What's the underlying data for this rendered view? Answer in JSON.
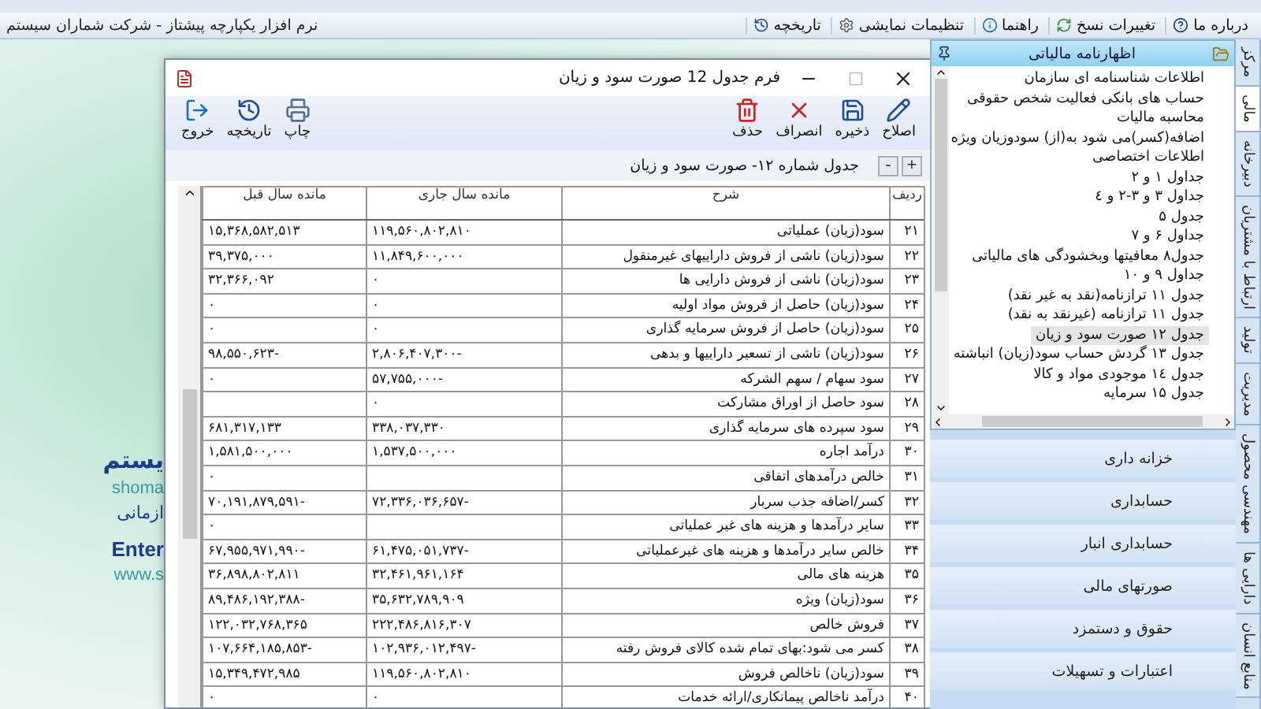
{
  "menu_bar": {
    "app_title": "نرم افزار یکپارچه پیشتاز - شرکت شماران سیستم",
    "items": [
      "درباره ما",
      "تغییرات نسخ",
      "راهنما",
      "تنظیمات نمایشی",
      "تاریخچه"
    ]
  },
  "background_logo": [
    {
      "text": "یستم",
      "kind": "title"
    },
    {
      "text": "shoma",
      "kind": "latin"
    },
    {
      "text": "ازمانی",
      "kind": "subtitle"
    },
    {
      "text": "Enter",
      "kind": "bold"
    },
    {
      "text": "www.s",
      "kind": "latin"
    }
  ],
  "dialog": {
    "title": "فرم جدول 12 صورت سود و زیان",
    "toolbar_right": [
      "اصلاح",
      "ذخیره",
      "انصراف",
      "حذف"
    ],
    "toolbar_left": [
      "چاپ",
      "تاریخچه",
      "خروج"
    ],
    "heading": "جدول شماره ۱۲- صورت سود و زیان",
    "expand_buttons": [
      "+",
      "-"
    ],
    "table": {
      "columns": [
        "ردیف",
        "شرح",
        "مانده سال جاری",
        "مانده سال قبل"
      ],
      "rows": [
        {
          "no": "۲۱",
          "description": "سود(زیان) عملیاتی",
          "current": "۱۱۹,۵۶۰,۸۰۲,۸۱۰",
          "previous": "۱۵,۳۶۸,۵۸۲,۵۱۳"
        },
        {
          "no": "۲۲",
          "description": "سود(زیان) ناشی از فروش داراییهای غیرمنقول",
          "current": "۱۱,۸۴۹,۶۰۰,۰۰۰",
          "previous": "۳۹,۳۷۵,۰۰۰"
        },
        {
          "no": "۲۳",
          "description": "سود(زیان) ناشی از فروش دارایی ها",
          "current": "۰",
          "previous": "۳۲,۳۶۶,۰۹۲"
        },
        {
          "no": "۲۴",
          "description": "سود(زیان) حاصل از فروش مواد اولیه",
          "current": "۰",
          "previous": "۰"
        },
        {
          "no": "۲۵",
          "description": "سود(زیان) حاصل از فروش سرمایه گذاری",
          "current": "۰",
          "previous": "۰"
        },
        {
          "no": "۲۶",
          "description": "سود(زیان) ناشی از تسعیر داراییها و بدهی",
          "current": "-۲,۸۰۶,۴۰۷,۳۰۰",
          "previous": "-۹۸,۵۵۰,۶۲۳"
        },
        {
          "no": "۲۷",
          "description": "سود سهام / سهم الشرکه",
          "current": "-۵۷,۷۵۵,۰۰۰",
          "previous": "۰"
        },
        {
          "no": "۲۸",
          "description": "سود حاصل از اوراق مشارکت",
          "current": "۰"
        },
        {
          "no": "۲۹",
          "description": "سود سپرده های سرمایه گذاری",
          "current": "۳۳۸,۰۳۷,۳۳۰",
          "previous": "۶۸۱,۳۱۷,۱۳۳"
        },
        {
          "no": "۳۰",
          "description": "درآمد اجاره",
          "current": "۱,۵۳۷,۵۰۰,۰۰۰",
          "previous": "۱,۵۸۱,۵۰۰,۰۰۰"
        },
        {
          "no": "۳۱",
          "description": "خالص درآمدهای اتفاقی",
          "previous": "۰"
        },
        {
          "no": "۳۲",
          "description": "کسر/اضافه جذب سربار",
          "current": "-۷۲,۳۳۶,۰۳۶,۶۵۷",
          "previous": "-۷۰,۱۹۱,۸۷۹,۵۹۱"
        },
        {
          "no": "۳۳",
          "description": "سایر درآمدها و هزینه های غیر عملیاتی",
          "previous": "۰"
        },
        {
          "no": "۳۴",
          "description": "خالص سایر درآمدها و هزینه های غیرعملیاتی",
          "current": "-۶۱,۴۷۵,۰۵۱,۷۳۷",
          "previous": "-۶۷,۹۵۵,۹۷۱,۹۹۰"
        },
        {
          "no": "۳۵",
          "description": "هزینه های مالی",
          "current": "۳۲,۴۶۱,۹۶۱,۱۶۴",
          "previous": "۳۶,۸۹۸,۸۰۲,۸۱۱"
        },
        {
          "no": "۳۶",
          "description": "سود(زیان) ویژه",
          "current": "۳۵,۶۳۲,۷۸۹,۹۰۹",
          "previous": "-۸۹,۴۸۶,۱۹۲,۳۸۸"
        },
        {
          "no": "۳۷",
          "description": "فروش خالص",
          "current": "۲۲۲,۴۸۶,۸۱۶,۳۰۷",
          "previous": "۱۲۲,۰۳۲,۷۶۸,۳۶۵"
        },
        {
          "no": "۳۸",
          "description": "کسر می شود:بهای تمام شده کالای فروش رفته",
          "current": "-۱۰۲,۹۳۶,۰۱۲,۴۹۷",
          "previous": "-۱۰۷,۶۶۴,۱۸۵,۸۵۳"
        },
        {
          "no": "۳۹",
          "description": "سود(زیان) ناخالص فروش",
          "current": "۱۱۹,۵۶۰,۸۰۲,۸۱۰",
          "previous": "۱۵,۳۴۹,۴۷۲,۹۸۵"
        },
        {
          "no": "۴۰",
          "description": "درآمد ناخالص پیمانکاری/ارائه خدمات",
          "current": "۰",
          "previous": "۰"
        }
      ]
    }
  },
  "tree_panel": {
    "title": "اظهارنامه مالیاتی",
    "items": [
      {
        "label": "اطلاعات شناسنامه ای سازمان",
        "selected": false
      },
      {
        "label": "حساب های بانکی فعالیت شخص حقوقی",
        "selected": false
      },
      {
        "label": "محاسبه مالیات",
        "selected": false
      },
      {
        "label": "اضافه(کسر)می شود به(از) سودوزیان ویژه",
        "selected": false
      },
      {
        "label": "اطلاعات اختصاصی",
        "selected": false
      },
      {
        "label": "جداول ۱ و ۲",
        "selected": false
      },
      {
        "label": "جداول ۳ و ۳-۲ و ٤",
        "selected": false
      },
      {
        "label": "جدول ۵",
        "selected": false
      },
      {
        "label": "جداول ۶ و ۷",
        "selected": false
      },
      {
        "label": "جدول۸ معافیتها وبخشودگی های مالیاتی",
        "selected": false
      },
      {
        "label": "جداول ۹ و ۱۰",
        "selected": false
      },
      {
        "label": "جدول ۱۱ ترازنامه(نقد به غیر نقد)",
        "selected": false
      },
      {
        "label": "جدول ۱۱ ترازنامه (غیرنقد به نقد)",
        "selected": false
      },
      {
        "label": "جدول ۱۲ صورت سود و زیان",
        "selected": true
      },
      {
        "label": "جدول ۱۳ گردش حساب سود(زیان) انباشته",
        "selected": false
      },
      {
        "label": "جدول ۱٤ موجودی مواد و کالا",
        "selected": false
      },
      {
        "label": "جدول ۱۵ سرمایه",
        "selected": false
      }
    ]
  },
  "modules": [
    "خزانه داری",
    "حسابداری",
    "حسابداری انبار",
    "صورتهای مالی",
    "حقوق و دستمزد",
    "اعتبارات و تسهیلات"
  ],
  "vertical_tabs": [
    {
      "label": "مرکز",
      "selected": false
    },
    {
      "label": "مالی",
      "selected": true
    },
    {
      "label": "دبیرخانه",
      "selected": false
    },
    {
      "label": "ارتباط با مشتریان",
      "selected": false
    },
    {
      "label": "تولید",
      "selected": false
    },
    {
      "label": "مدیریت",
      "selected": false
    },
    {
      "label": "مهندسی محصول",
      "selected": false
    },
    {
      "label": "دارایی ها",
      "selected": false
    },
    {
      "label": "منابع انسان",
      "selected": false
    }
  ]
}
